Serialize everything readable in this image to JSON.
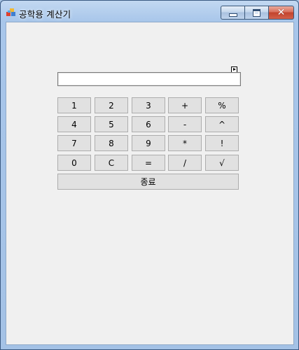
{
  "window": {
    "title": "공학용 계산기",
    "icon": "app-icon",
    "controls": {
      "minimize_icon": "minimize-icon",
      "maximize_icon": "maximize-icon",
      "close_icon": "close-icon",
      "close_glyph": "✕"
    }
  },
  "display": {
    "value": ""
  },
  "keypad": {
    "rows": [
      [
        "1",
        "2",
        "3",
        "+",
        "%"
      ],
      [
        "4",
        "5",
        "6",
        "-",
        "^"
      ],
      [
        "7",
        "8",
        "9",
        "*",
        "!"
      ],
      [
        "0",
        "C",
        "=",
        "/",
        "√"
      ]
    ],
    "exit_label": "종료"
  },
  "colors": {
    "title_bar": "#a8c6ea",
    "client_background": "#f0f0f0",
    "button_face": "#e1e1e1",
    "button_border": "#adadad",
    "close_button": "#c2432c"
  }
}
